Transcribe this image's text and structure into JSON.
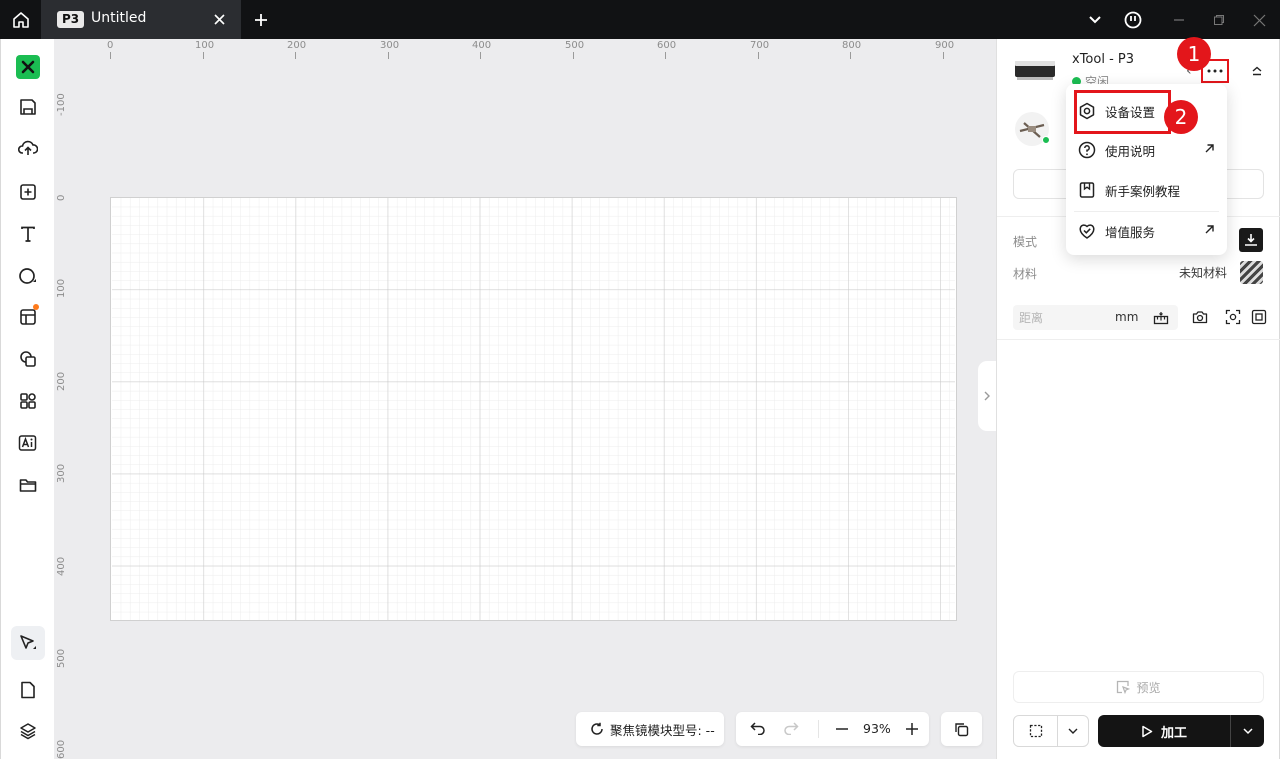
{
  "titlebar": {
    "tab_badge": "P3",
    "tab_title": "Untitled"
  },
  "canvas": {
    "ruler_top": [
      "0",
      "100",
      "200",
      "300",
      "400",
      "500",
      "600",
      "700",
      "800",
      "900"
    ],
    "ruler_left": [
      "-100",
      "0",
      "100",
      "200",
      "300",
      "400",
      "500",
      "600"
    ],
    "focus_label": "聚焦镜模块型号: --",
    "zoom": "93%"
  },
  "device": {
    "name": "xTool - P3",
    "status": "空闲",
    "status_color": "#1bbd52"
  },
  "annotations": {
    "step1": "1",
    "step2": "2",
    "highlight_color": "#e3161b"
  },
  "menu": {
    "items": [
      {
        "label": "设备设置",
        "icon": "gear-hex-icon",
        "external": false
      },
      {
        "label": "使用说明",
        "icon": "help-icon",
        "external": true
      },
      {
        "label": "新手案例教程",
        "icon": "bookmark-icon",
        "external": false
      },
      {
        "label": "增值服务",
        "icon": "shield-check-icon",
        "external": true
      }
    ]
  },
  "panel": {
    "mode_label": "模式",
    "material_label": "材料",
    "material_value": "未知材料",
    "distance_placeholder": "距离",
    "distance_unit": "mm",
    "preview_label": "预览",
    "process_label": "加工"
  }
}
